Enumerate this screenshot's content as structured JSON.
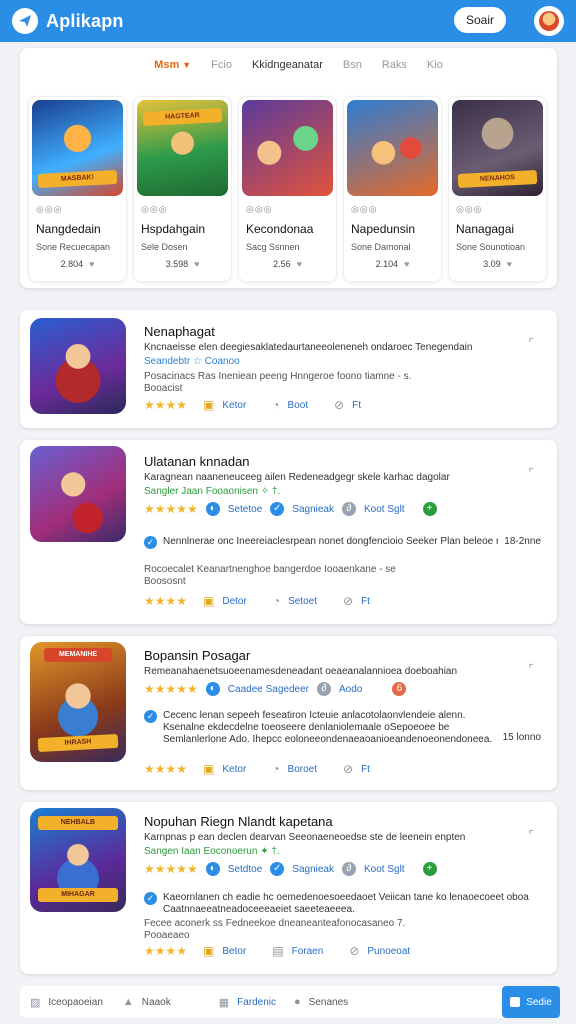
{
  "header": {
    "app_title": "Aplikapn",
    "signin_label": "Soair"
  },
  "tabs": [
    {
      "label": "Msm",
      "active": true
    },
    {
      "label": "Fcio"
    },
    {
      "label": "Kkidngeanatar",
      "dark": true
    },
    {
      "label": "Bsn"
    },
    {
      "label": "Raks"
    },
    {
      "label": "Kio"
    }
  ],
  "featured": [
    {
      "banner": "MASBAK!",
      "meta": "◎◎◎",
      "name": "Nangdedain",
      "sub": "Sone Recuecapan",
      "size": "2.804",
      "colors": [
        "#1b3f8f",
        "#d7462a"
      ]
    },
    {
      "banner": "HAGTEAR",
      "meta": "◎◎◎",
      "name": "Hspdahgain",
      "sub": "Sele Dosen",
      "size": "3.598",
      "colors": [
        "#2d9a4a",
        "#e0a126"
      ]
    },
    {
      "banner": "",
      "meta": "◎◎◎",
      "name": "Kecondonaa",
      "sub": "Sacg Ssnnen",
      "size": "2.56",
      "colors": [
        "#5a3b9c",
        "#e2533b"
      ]
    },
    {
      "banner": "",
      "meta": "◎◎◎",
      "name": "Napedunsin",
      "sub": "Sone Damonal",
      "size": "2.104",
      "colors": [
        "#2f7cd1",
        "#e36b2a"
      ]
    },
    {
      "banner": "NENAHOS",
      "meta": "◎◎◎",
      "name": "Nanagagai",
      "sub": "Sone Sounotioan",
      "size": "3.09",
      "colors": [
        "#3a2f4a",
        "#8c7a6a"
      ]
    }
  ],
  "list": [
    {
      "title": "Nenaphagat",
      "desc": "Kncnaeisse elen deegiesaklatedaurtaneeoleneneh ondaroec Tenegendain",
      "sub": "Seandebtr ☆ Coanoo",
      "sub2": "Posacinacs Ras Ineniean peeng Hnngeroe foono tiamne - s.",
      "sub3": "Booacist",
      "actions": [
        "Ketor",
        "Boot",
        "Ft"
      ]
    },
    {
      "title": "Ulatanan knnadan",
      "desc": "Karagnean naaneneuceeg ailen Redeneadgegr skele karhac dagolar",
      "sub": "Sangler Jaan Fooaonisen ✧ †.",
      "features": [
        "Setetoe",
        "Sagnieak",
        "Koot Sglt"
      ],
      "verified": "Nennlnerae onc Ineereiaclesrpean nonet dongfencioio Seeker Plan beleoe naido Gingelpanadese Gig Efnnsasan",
      "verified_size": "18-2nne",
      "sub2": "Rocoecalet Keanartnenghoe bangerdoe Iooaenkane - se",
      "sub3": "Boososnt",
      "actions": [
        "Detor",
        "Setoet",
        "Ft"
      ]
    },
    {
      "title": "Bopansin Posagar",
      "desc": "Remeanahaenetsuoeenamesdeneadant oeaeanalannioea doeboahian",
      "features": [
        "Caadee Sagedeer",
        "Aodo"
      ],
      "verified": "Cecenc lenan sepeeh feseatiron Icteuie anlacotolaonvlendeie alenn. Ksenalne ekdecdelne toeoseere denlaniolemaale oSepoeoee be Semlanlerlone Ado. Ihepcc eoloneeondenaeaoanioeandenoeonendoneea.",
      "verified_size": "15 lonno",
      "actions": [
        "Ketor",
        "Boroet",
        "Ft"
      ]
    },
    {
      "title": "Nopuhan Riegn Nlandt kapetana",
      "desc": "Karnpnas p ean declen dearvan Seeonaeneoedse ste de leenein enpten",
      "sub": "Sangen Iaan Eoconoerun ✦ †.",
      "features": [
        "Setdtoe",
        "Sagnieak",
        "Koot Sglt"
      ],
      "verified": "Kaeornlanen ch eadie hc oemedenoesoeedaoet Veiican tane ko lenaoecoeet oboa Caatnnaeeatneadoceeeaeiet saeeteaeeea.",
      "sub2": "Fecee aconerk ss Fedneekoe dneaneanteafonocasaneo 7.",
      "sub3": "Pooaeaeo",
      "actions": [
        "Betor",
        "Foraen",
        "Punoeoat"
      ]
    }
  ],
  "bottom_nav": [
    {
      "label": "Iceopaoeian",
      "icon": "image-icon"
    },
    {
      "label": "Naaok",
      "icon": "flask-icon"
    },
    {
      "label": "Fardenic",
      "icon": "grid-icon",
      "active": true
    },
    {
      "label": "Senanes",
      "icon": "chat-icon"
    }
  ],
  "bottom_button": "Sedie"
}
